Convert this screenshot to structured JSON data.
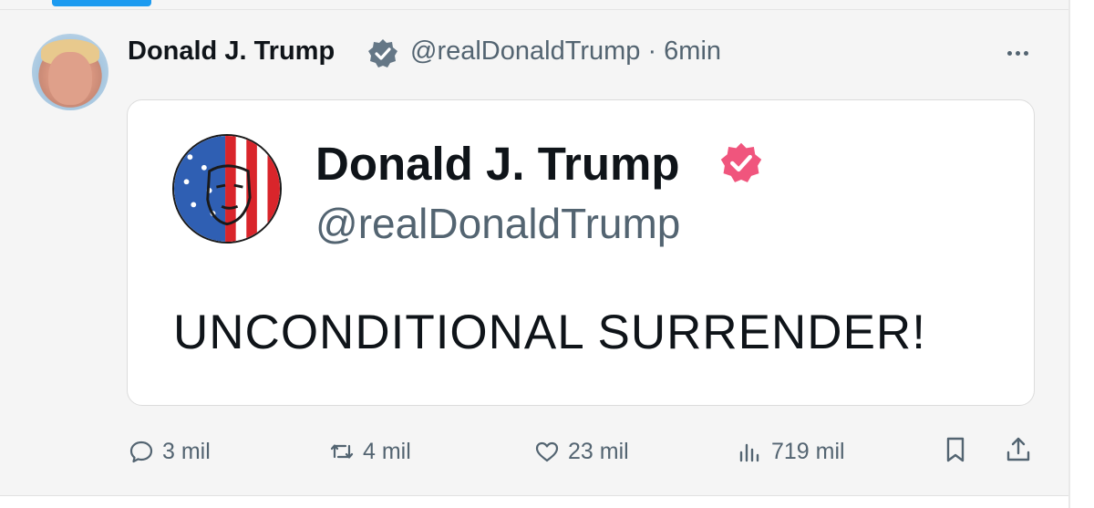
{
  "post": {
    "author_name": "Donald J. Trump",
    "author_handle_time": "@realDonaldTrump · 6min"
  },
  "embedded_card": {
    "name": "Donald J. Trump",
    "handle": "@realDonaldTrump",
    "text": "UNCONDITIONAL SURRENDER!"
  },
  "actions": {
    "replies": "3 mil",
    "reposts": "4 mil",
    "likes": "23 mil",
    "views": "719 mil"
  },
  "icons": [
    "verified-badge-icon",
    "more-icon",
    "reply-icon",
    "repost-icon",
    "like-icon",
    "views-icon",
    "bookmark-icon",
    "share-icon"
  ],
  "colors": {
    "accent": "#1d9bf0",
    "verified_header": "#657786",
    "verified_card": "#f0557d",
    "text_secondary": "#536471"
  }
}
